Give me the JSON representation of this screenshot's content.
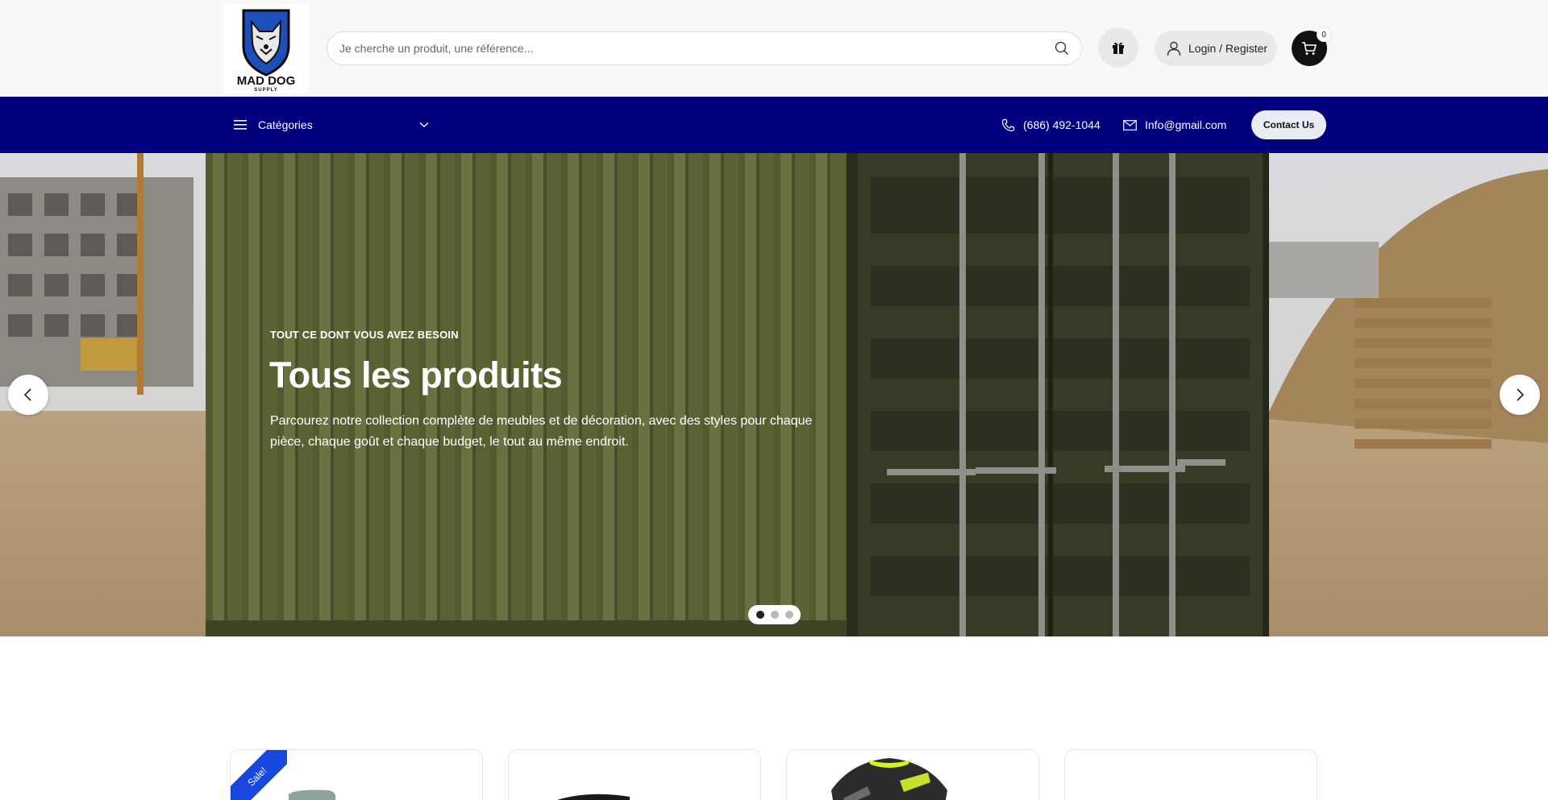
{
  "brand": {
    "logo_text_top": "MAD DOG",
    "logo_text_bottom": "SUPPLY"
  },
  "search": {
    "placeholder": "Je cherche un produit, une référence...",
    "icon": "search-icon"
  },
  "header": {
    "gift_icon": "gift-icon",
    "login_label": "Login / Register",
    "user_icon": "user-icon",
    "cart_icon": "cart-icon",
    "cart_count": "0"
  },
  "nav": {
    "categories_label": "Catégories",
    "phone": "(686) 492-1044",
    "email": "Info@gmail.com",
    "contact_label": "Contact Us"
  },
  "hero": {
    "eyebrow": "TOUT CE DONT VOUS AVEZ BESOIN",
    "title": "Tous les produits",
    "text": "Parcourez notre collection complète de meubles et de décoration, avec des styles pour chaque pièce, chaque goût et chaque budget, le tout au même endroit.",
    "slides": 3,
    "active_slide": 1
  },
  "products": {
    "sale_badge": "Sale!"
  },
  "colors": {
    "nav_bg": "#00007f",
    "header_bg": "#faf8f7",
    "sale_blue": "#1847e0",
    "container_green": "#5a6133"
  }
}
